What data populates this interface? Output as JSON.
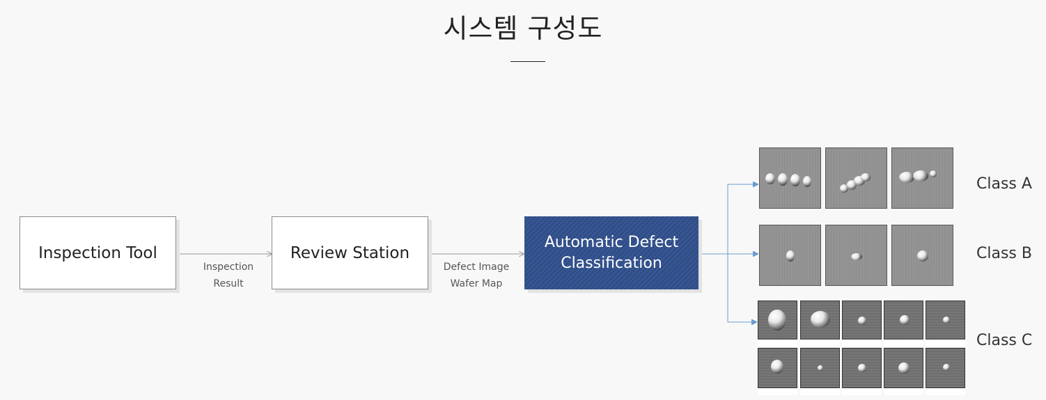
{
  "title": "시스템 구성도",
  "nodes": {
    "inspection_tool": "Inspection Tool",
    "review_station": "Review Station",
    "adc_line1": "Automatic Defect",
    "adc_line2": "Classification"
  },
  "edges": {
    "edge1_line1": "Inspection",
    "edge1_line2": "Result",
    "edge2_line1": "Defect Image",
    "edge2_line2": "Wafer Map"
  },
  "classes": {
    "a": "Class A",
    "b": "Class B",
    "c": "Class C"
  },
  "colors": {
    "background": "#f8f8f8",
    "adc_fill": "#2f4d87",
    "arrow_gray": "#999999",
    "arrow_blue": "#6a9bd0"
  }
}
